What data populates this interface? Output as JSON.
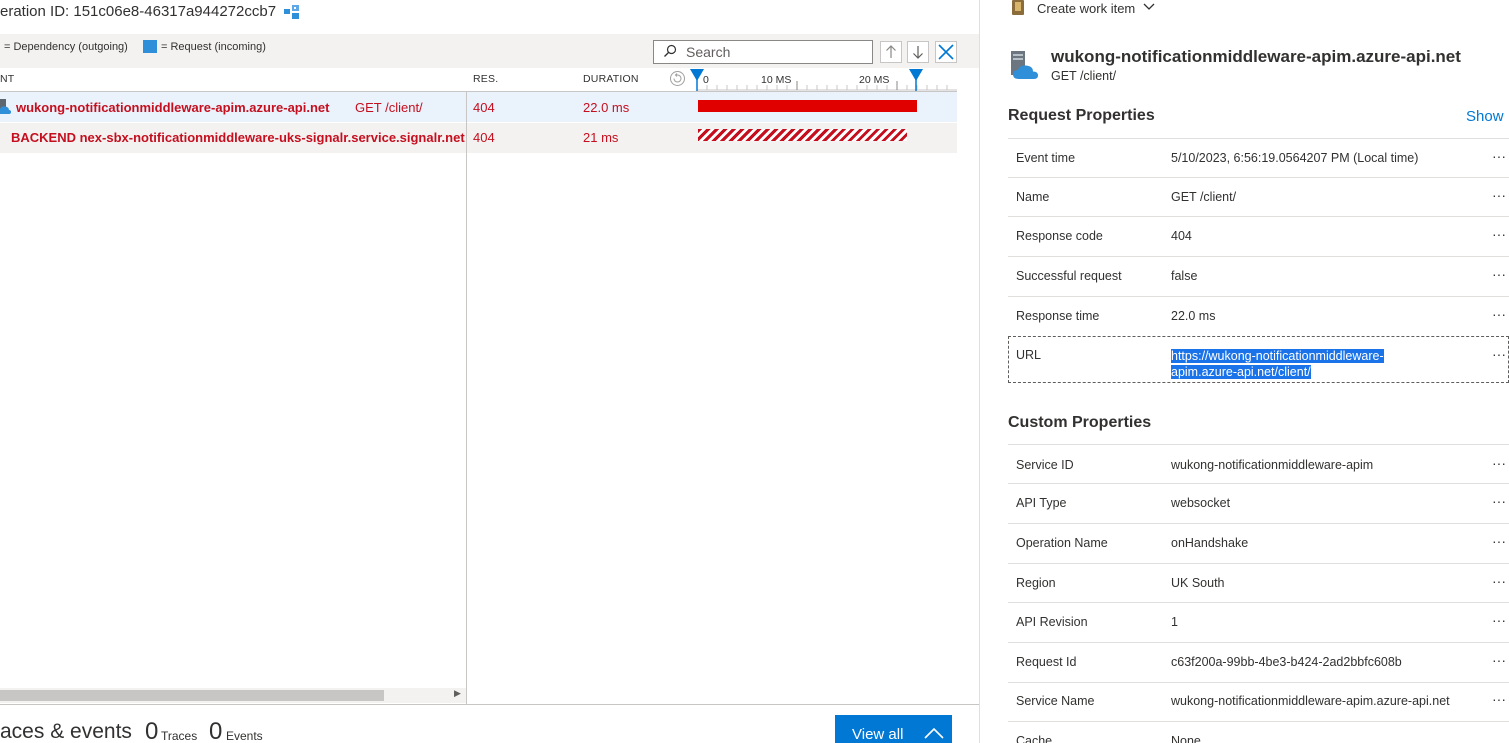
{
  "left": {
    "operation_id": "eration ID: 151c06e8-46317a944272ccb7",
    "legend": {
      "dependency": "= Dependency (outgoing)",
      "request": "= Request (incoming)"
    },
    "search": {
      "placeholder": "Search"
    },
    "columns": {
      "event": "NT",
      "res": "RES.",
      "duration": "DURATION"
    },
    "axis_ticks": [
      "0",
      "10 MS",
      "20 MS"
    ],
    "rows": [
      {
        "name": "wukong-notificationmiddleware-apim.azure-api.net",
        "detail": "GET /client/",
        "res": "404",
        "duration": "22.0 ms",
        "bar_fraction": 1.0
      },
      {
        "name": "BACKEND nex-sbx-notificationmiddleware-uks-signalr.service.signalr.net",
        "res": "404",
        "duration": "21 ms",
        "bar_fraction": 0.954
      }
    ],
    "traces_events": {
      "title": "aces & events",
      "traces_count": "0",
      "traces_label": "Traces",
      "events_count": "0",
      "events_label": "Events",
      "view_all": "View all"
    }
  },
  "right": {
    "create_work_item": "Create work item",
    "title": "wukong-notificationmiddleware-apim.azure-api.net",
    "subtitle": "GET /client/",
    "request_properties": {
      "heading": "Request Properties",
      "show_link": "Show",
      "items": [
        {
          "name": "Event time",
          "value": "5/10/2023, 6:56:19.0564207 PM (Local time)"
        },
        {
          "name": "Name",
          "value": "GET /client/"
        },
        {
          "name": "Response code",
          "value": "404"
        },
        {
          "name": "Successful request",
          "value": "false"
        },
        {
          "name": "Response time",
          "value": "22.0 ms"
        }
      ],
      "url": {
        "name": "URL",
        "line1": "https://wukong-notificationmiddleware-",
        "line2": "apim.azure-api.net/client/"
      }
    },
    "custom_properties": {
      "heading": "Custom Properties",
      "items": [
        {
          "name": "Service ID",
          "value": "wukong-notificationmiddleware-apim"
        },
        {
          "name": "API Type",
          "value": "websocket"
        },
        {
          "name": "Operation Name",
          "value": "onHandshake"
        },
        {
          "name": "Region",
          "value": "UK South"
        },
        {
          "name": "API Revision",
          "value": "1"
        },
        {
          "name": "Request Id",
          "value": "c63f200a-99bb-4be3-b424-2ad2bbfc608b"
        },
        {
          "name": "Service Name",
          "value": "wukong-notificationmiddleware-apim.azure-api.net"
        },
        {
          "name": "Cache",
          "value": "None"
        }
      ]
    },
    "more_glyph": "···"
  },
  "colors": {
    "error": "#c50f1f",
    "accent": "#0078d4",
    "request_swatch": "#2f8fd8",
    "row_selected": "#eaf2fb"
  }
}
